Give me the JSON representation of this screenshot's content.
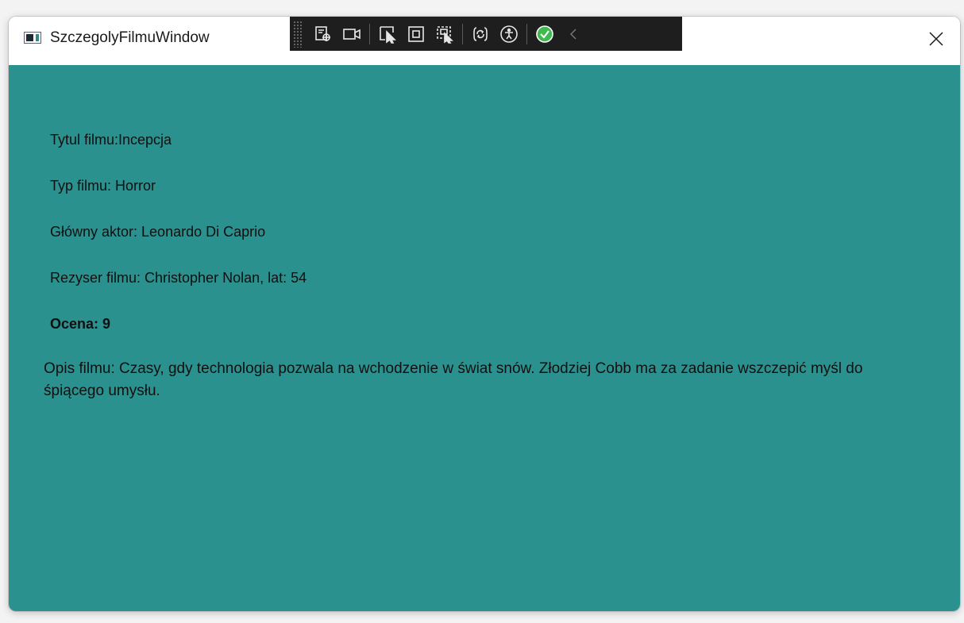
{
  "window": {
    "title": "SzczegolyFilmuWindow",
    "close_icon": "close-icon"
  },
  "toolbar": {
    "buttons": [
      {
        "icon": "live-visual-tree-icon"
      },
      {
        "icon": "camera-icon"
      },
      {
        "icon": "select-element-icon"
      },
      {
        "icon": "display-layout-adorners-icon"
      },
      {
        "icon": "track-focused-element-icon"
      },
      {
        "icon": "hot-reload-icon"
      },
      {
        "icon": "accessibility-icon"
      },
      {
        "icon": "status-check-icon"
      },
      {
        "icon": "collapse-chevron-icon"
      }
    ]
  },
  "movie": {
    "title_line": "Tytul filmu:Incepcja",
    "type_line": "Typ filmu: Horror",
    "actor_line": "Główny aktor: Leonardo Di Caprio",
    "director_line": "Rezyser filmu: Christopher Nolan, lat: 54",
    "rating_line": "Ocena: 9",
    "description": "Opis filmu: Czasy, gdy technologia pozwala na wchodzenie w świat snów. Złodziej Cobb ma za zadanie wszczepić myśl do śpiącego umysłu."
  },
  "colors": {
    "content_background": "#2b918f",
    "toolbar_background": "#1e1e1e",
    "status_green": "#3fb950"
  }
}
